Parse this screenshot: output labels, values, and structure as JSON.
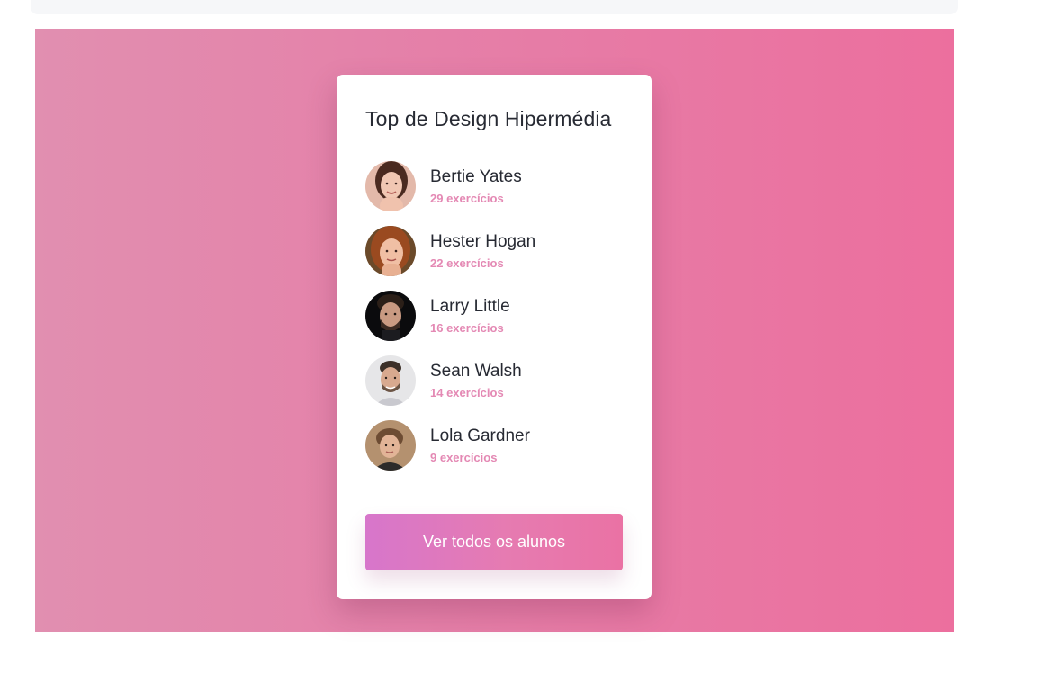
{
  "card": {
    "title": "Top de Design Hipermédia",
    "students": [
      {
        "name": "Bertie Yates",
        "count": "29 exercícios",
        "avatar": "woman-smiling-photo"
      },
      {
        "name": "Hester Hogan",
        "count": "22 exercícios",
        "avatar": "woman-red-hair-photo"
      },
      {
        "name": "Larry Little",
        "count": "16 exercícios",
        "avatar": "man-dark-background-photo"
      },
      {
        "name": "Sean Walsh",
        "count": "14 exercícios",
        "avatar": "man-smiling-photo"
      },
      {
        "name": "Lola Gardner",
        "count": "9 exercícios",
        "avatar": "woman-short-hair-photo"
      }
    ],
    "button_label": "Ver todos os alunos"
  },
  "colors": {
    "background_gradient_start": "#e18fb0",
    "background_gradient_end": "#ec6f9e",
    "accent": "#e489b4",
    "button_gradient_start": "#d776cb",
    "button_gradient_end": "#ea72a4",
    "text": "#272a33"
  }
}
